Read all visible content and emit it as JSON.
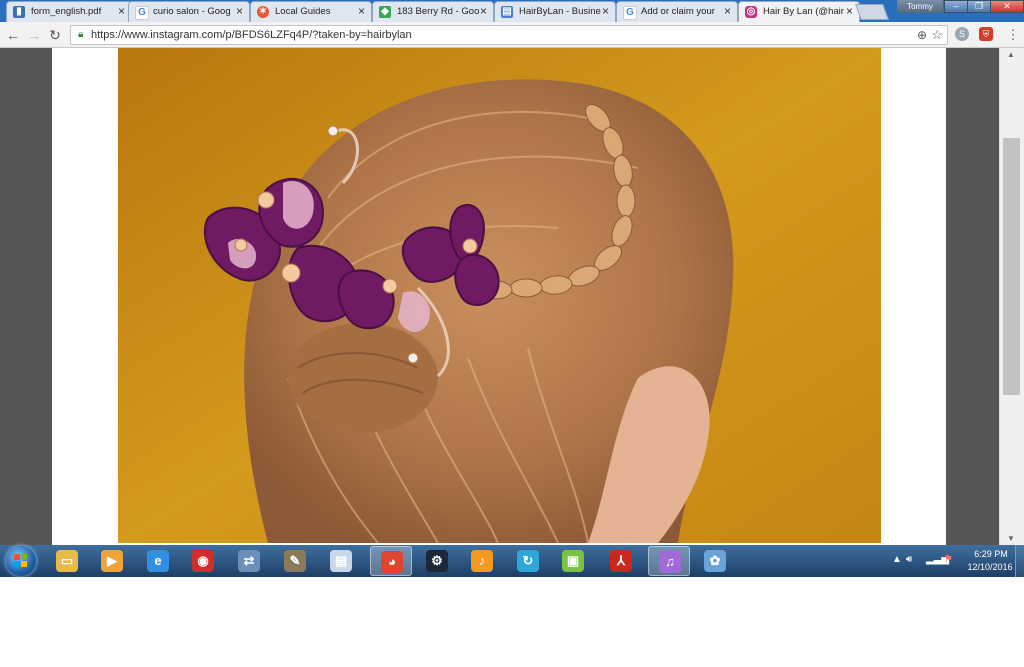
{
  "tabs": [
    {
      "title": "form_english.pdf",
      "icon": "pdf-doc-icon",
      "color": "#3b6fb6",
      "active": false
    },
    {
      "title": "curio salon - Goog",
      "icon": "google-icon",
      "color": "#4285f4",
      "active": false
    },
    {
      "title": "Local Guides",
      "icon": "local-guides-icon",
      "color": "#e8542f",
      "active": false
    },
    {
      "title": "183 Berry Rd - Goo",
      "icon": "maps-icon",
      "color": "#34a853",
      "active": false
    },
    {
      "title": "HairByLan - Busine",
      "icon": "business-icon",
      "color": "#4a7fd0",
      "active": false
    },
    {
      "title": "Add or claim your",
      "icon": "google-icon",
      "color": "#4285f4",
      "active": false
    },
    {
      "title": "Hair By Lan (@hair",
      "icon": "instagram-icon",
      "color": "#c13584",
      "active": true
    }
  ],
  "profile": "Tommy",
  "address": {
    "url": "https://www.instagram.com/p/BFDS6LZFq4P/?taken-by=hairbylan"
  },
  "taskbar": {
    "apps": [
      {
        "name": "file-explorer-icon",
        "color": "#e9b949"
      },
      {
        "name": "media-player-icon",
        "color": "#f2a23a"
      },
      {
        "name": "internet-explorer-icon",
        "color": "#2f8fe0"
      },
      {
        "name": "disc-app-icon",
        "color": "#d22d2d"
      },
      {
        "name": "network-app-icon",
        "color": "#6b8fb8"
      },
      {
        "name": "gimp-icon",
        "color": "#8a7a5a"
      },
      {
        "name": "document-app-icon",
        "color": "#c8d8e8"
      },
      {
        "name": "chrome-icon",
        "color": "#e0462f",
        "active": true
      },
      {
        "name": "steam-icon",
        "color": "#1b2838"
      },
      {
        "name": "fl-studio-icon",
        "color": "#f29a1f"
      },
      {
        "name": "sync-app-icon",
        "color": "#2da7d8"
      },
      {
        "name": "android-app-icon",
        "color": "#7cc142"
      },
      {
        "name": "acrobat-icon",
        "color": "#c8281d"
      },
      {
        "name": "itunes-icon",
        "color": "#a06ad8",
        "active": true
      },
      {
        "name": "paint-app-icon",
        "color": "#6aa3d8"
      }
    ],
    "clock_time": "6:29 PM",
    "clock_date": "12/10/2016"
  }
}
